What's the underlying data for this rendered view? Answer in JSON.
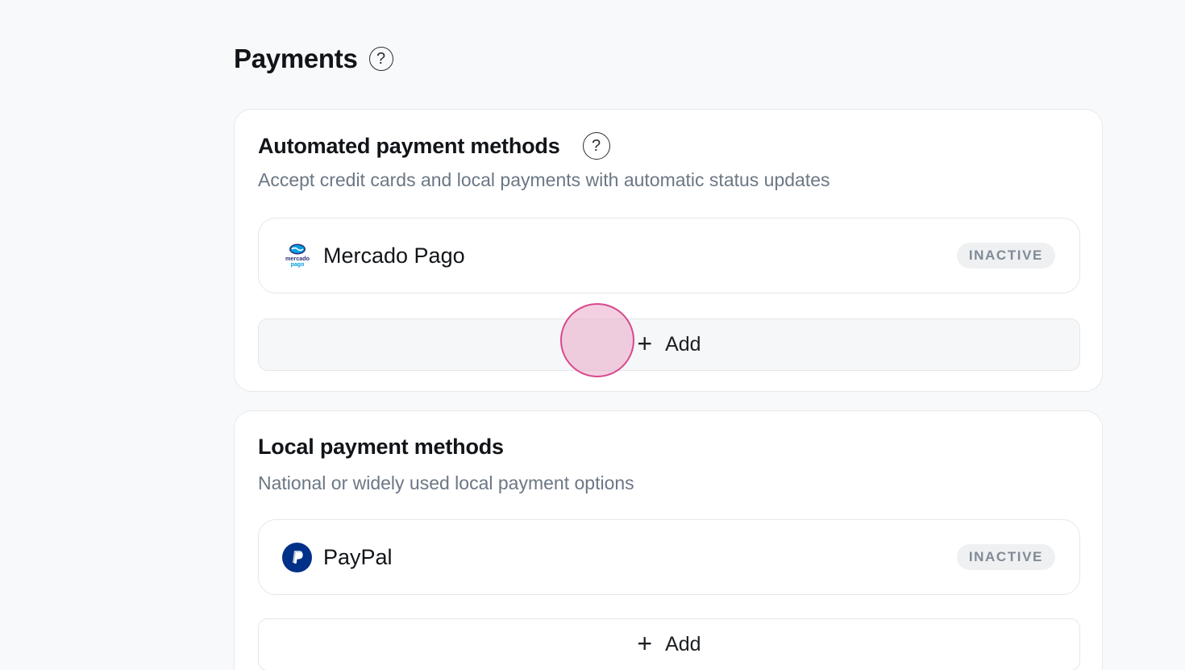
{
  "page": {
    "title": "Payments"
  },
  "sections": [
    {
      "title": "Automated payment methods",
      "subtitle": "Accept credit cards and local payments with automatic status updates",
      "methods": [
        {
          "name": "Mercado Pago",
          "status": "INACTIVE",
          "logo": "mercado-pago-logo"
        }
      ],
      "add_label": "Add"
    },
    {
      "title": "Local payment methods",
      "subtitle": "National or widely used local payment options",
      "methods": [
        {
          "name": "PayPal",
          "status": "INACTIVE",
          "logo": "paypal-logo"
        }
      ],
      "add_label": "Add"
    }
  ],
  "icons": {
    "help": "?",
    "plus": "+"
  },
  "colors": {
    "background": "#f8f9fa",
    "card": "#ffffff",
    "subtitle": "#6b7785",
    "badge_bg": "#eef0f2",
    "badge_text": "#808a95",
    "paypal_blue": "#003087",
    "mercado_pago_blue": "#009ee3",
    "click_indicator": "#d9478d"
  }
}
